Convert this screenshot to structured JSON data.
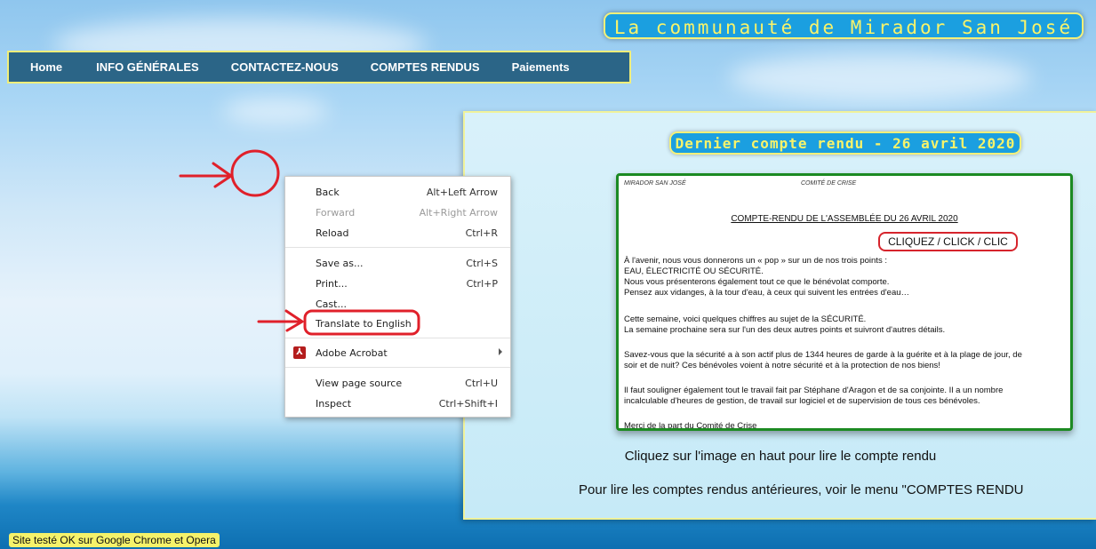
{
  "site": {
    "title": "La communauté de Mirador San José"
  },
  "nav": {
    "items": [
      {
        "label": "Home"
      },
      {
        "label": "INFO GÉNÉRALES"
      },
      {
        "label": "CONTACTEZ-NOUS"
      },
      {
        "label": "COMPTES RENDUS"
      },
      {
        "label": "Paiements"
      }
    ]
  },
  "report": {
    "heading": "Dernier compte rendu - 26 avril 2020",
    "doc": {
      "header_left": "MIRADOR SAN JOSÉ",
      "header_right": "COMITÉ DE CRISE",
      "title": "COMPTE-RENDU DE L'ASSEMBLÉE DU 26 AVRIL 2020",
      "click_label": "CLIQUEZ / CLICK / CLIC",
      "p1": "À l'avenir, nous vous donnerons un « pop » sur un de nos trois points : EAU, ÉLECTRICITÉ OU SÉCURITÉ. Nous vous présenterons également tout ce que le bénévolat comporte. Pensez aux vidanges, à la tour d'eau, à ceux qui suivent les entrées d'eau…",
      "p1_lines": [
        "À l'avenir, nous vous donnerons un « pop » sur un de nos trois points :",
        "EAU, ÉLECTRICITÉ OU SÉCURITÉ.",
        "Nous vous présenterons également tout ce que le bénévolat comporte.",
        "Pensez aux vidanges, à la tour d'eau, à ceux qui suivent les entrées d'eau…"
      ],
      "p2_lines": [
        "Cette semaine, voici quelques chiffres au sujet de la SÉCURITÉ.",
        "La semaine prochaine sera sur l'un des deux autres points et suivront d'autres détails."
      ],
      "p3_lines": [
        "Savez-vous que la sécurité a à son actif plus de 1344 heures de garde à la guérite et à la plage de jour, de",
        "soir et de nuit?     Ces bénévoles voient à notre sécurité et à la protection de nos biens!"
      ],
      "p4_lines": [
        "Il faut souligner également tout le travail fait par Stéphane d'Aragon et de sa conjointe. Il a un nombre",
        "incalculable d'heures de gestion, de travail sur logiciel et de supervision de tous ces bénévoles."
      ],
      "p5": "Merci de la part du Comité de Crise"
    },
    "caption1": "Cliquez sur l'image en haut pour lire le compte rendu",
    "caption2": "Pour lire les comptes rendus antérieures, voir le menu \"COMPTES RENDU"
  },
  "context_menu": {
    "items": [
      {
        "label": "Back",
        "shortcut": "Alt+Left Arrow"
      },
      {
        "label": "Forward",
        "shortcut": "Alt+Right Arrow"
      },
      {
        "label": "Reload",
        "shortcut": "Ctrl+R"
      },
      {
        "label": "Save as...",
        "shortcut": "Ctrl+S"
      },
      {
        "label": "Print...",
        "shortcut": "Ctrl+P"
      },
      {
        "label": "Cast...",
        "shortcut": ""
      },
      {
        "label": "Translate to English",
        "shortcut": ""
      },
      {
        "label": "Adobe Acrobat",
        "shortcut": ""
      },
      {
        "label": "View page source",
        "shortcut": "Ctrl+U"
      },
      {
        "label": "Inspect",
        "shortcut": "Ctrl+Shift+I"
      }
    ],
    "acrobat_icon": "adobe-acrobat-icon"
  },
  "footer": {
    "note": "Site testé OK sur Google Chrome et Opera"
  },
  "colors": {
    "accent_yellow": "#f8f36a",
    "title_bg": "#1b9fe0",
    "nav_bg": "#2b6587",
    "annotation_red": "#e0202a",
    "doc_border": "#1c8a22"
  }
}
